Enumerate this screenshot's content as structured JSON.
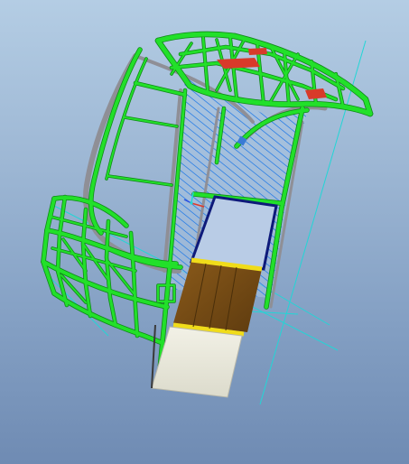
{
  "viewport": {
    "background_top": "#b4cde4",
    "background_bottom": "#6f8bb3"
  },
  "model": {
    "frame_color": "#22e02a",
    "frame_dark": "#0f8a17",
    "body_gray": "#8f8f96",
    "hatch_color": "#2b7fe6",
    "accent_red": "#d83a2a",
    "panel_blue_edge": "#0e1a7a",
    "panel_brown": "#7a4f16",
    "panel_yellow": "#f0dc1a",
    "panel_white": "#ecebdf",
    "datum_cyan": "#22d6d6"
  },
  "icons": {
    "coordinate_system": "csys-icon"
  }
}
